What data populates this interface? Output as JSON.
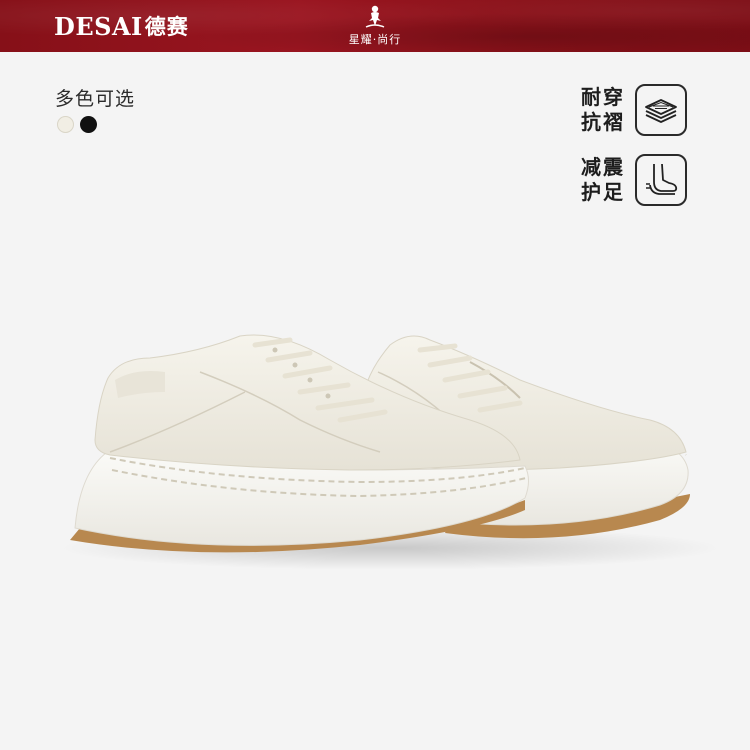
{
  "header": {
    "brand_latin": "DESAI",
    "brand_cn": "德赛",
    "slogan": "星耀·尚行",
    "colors": {
      "banner": "#8e1119",
      "text": "#ffffff"
    }
  },
  "colors_section": {
    "label": "多色可选",
    "swatches": [
      {
        "name": "white",
        "color": "#f1eee4"
      },
      {
        "name": "black",
        "color": "#111111"
      }
    ]
  },
  "features": [
    {
      "line1": "耐穿",
      "line2": "抗褶",
      "icon": "layered-sole-icon"
    },
    {
      "line1": "减震",
      "line2": "护足",
      "icon": "foot-cushion-icon"
    }
  ],
  "product": {
    "description": "",
    "upper_color": "#efece2",
    "outsole_color": "#b88a52"
  }
}
